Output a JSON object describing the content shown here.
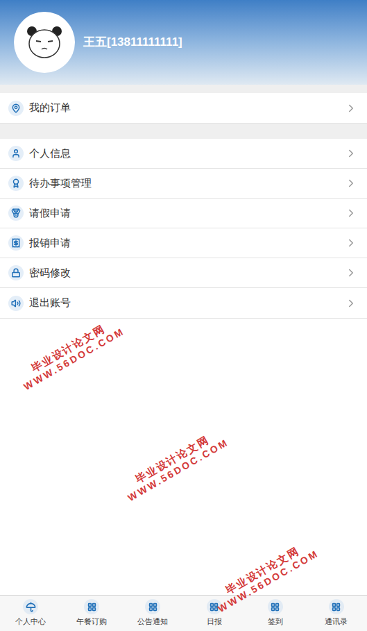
{
  "header": {
    "name": "王五[13811111111]"
  },
  "menu_groups": [
    {
      "items": [
        {
          "label": "我的订单"
        }
      ]
    },
    {
      "items": [
        {
          "label": "个人信息"
        },
        {
          "label": "待办事项管理"
        },
        {
          "label": "请假申请"
        },
        {
          "label": "报销申请"
        },
        {
          "label": "密码修改"
        },
        {
          "label": "退出账号"
        }
      ]
    }
  ],
  "tab_bar": [
    {
      "label": "个人中心",
      "selected": true
    },
    {
      "label": "午餐订购",
      "selected": false
    },
    {
      "label": "公告通知",
      "selected": false
    },
    {
      "label": "日报",
      "selected": false
    },
    {
      "label": "签到",
      "selected": false
    },
    {
      "label": "通讯录",
      "selected": false
    }
  ],
  "watermarks": [
    {
      "lines": [
        "毕业设计论文网",
        "WWW.56DOC.COM"
      ]
    },
    {
      "lines": [
        "毕业设计论文网",
        "WWW.56DOC.COM"
      ]
    },
    {
      "lines": [
        "毕业设计论文网",
        "WWW.56DOC.COM"
      ]
    }
  ]
}
